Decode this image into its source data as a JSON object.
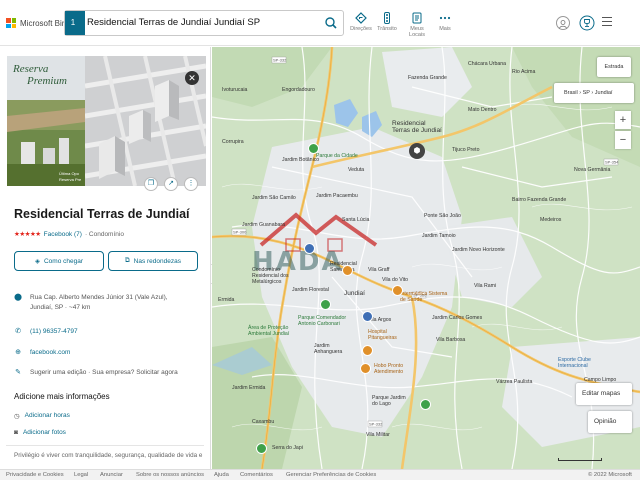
{
  "header": {
    "brand": "Microsoft Bing",
    "route_number": "1",
    "search_query": "Residencial Terras de Jundiaí Jundiaí SP",
    "nav": [
      {
        "label": "Direções",
        "icon": "directions-icon"
      },
      {
        "label": "Trânsito",
        "icon": "traffic-icon"
      },
      {
        "label": "Meus Locais",
        "icon": "my-places-icon"
      },
      {
        "label": "Mais",
        "icon": "more-icon"
      }
    ]
  },
  "panel": {
    "photo_caption_line1": "Reserva",
    "photo_caption_line2": "Premium",
    "photo_small_line1": "Última Opo",
    "photo_small_line2": "Reserva Pre",
    "name": "Residencial Terras de Jundiaí",
    "stars": "★★★★★",
    "reviews": "Facebook (7)",
    "category": "· Condomínio",
    "directions_label": "Como chegar",
    "nearby_label": "Nas redondezas",
    "address": "Rua Cap. Alberto Mendes Júnior 31 (Vale Azul), Jundiaí, SP · ~47 km",
    "phone": "(11) 96357-4797",
    "website": "facebook.com",
    "suggest": "Sugerir uma edição · Sua empresa? Solicitar agora",
    "more_info_title": "Adicione mais informações",
    "add_hours": "Adicionar horas",
    "add_photos": "Adicionar fotos",
    "description": "Privilégio é viver com tranquilidade, segurança, qualidade de vida e a"
  },
  "map": {
    "style_button": "Estrada",
    "location": "Brasil › SP › Jundiaí",
    "zoom_in": "+",
    "zoom_out": "−",
    "edit_maps": "Editar mapas",
    "feedback": "Opinião",
    "watermark": "HADA",
    "labels": [
      {
        "t": "Residencial",
        "c": "big"
      },
      {
        "t": "Terras de Jundiaí",
        "c": "big"
      },
      {
        "t": "Parque da Cidade",
        "c": "green"
      },
      {
        "t": "Veduta",
        "c": "dark"
      },
      {
        "t": "Nova Germânia",
        "c": "dark"
      },
      {
        "t": "Jundiaí",
        "c": "big"
      },
      {
        "t": "Vila Graff",
        "c": "dark"
      },
      {
        "t": "Vila do Vito",
        "c": "dark"
      },
      {
        "t": "Vila Argos",
        "c": "dark"
      },
      {
        "t": "Hospital Pitangueiras",
        "c": "orange"
      },
      {
        "t": "Intermédica Sistema de Saúde",
        "c": "orange"
      },
      {
        "t": "Hobo Pronto Atendimento",
        "c": "orange"
      },
      {
        "t": "Parque Jardim do Lago",
        "c": "dark"
      },
      {
        "t": "Jardim Anhanguera",
        "c": "dark"
      },
      {
        "t": "Condomínio Residencial dos Metalúrgicos",
        "c": "dark"
      },
      {
        "t": "Parque Comendador Antonio Carbonari",
        "c": "green"
      },
      {
        "t": "Área de Proteção Ambiental Jundiaí",
        "c": "green"
      },
      {
        "t": "Vila Militar",
        "c": "dark"
      },
      {
        "t": "Várzea Paulista",
        "c": "dark"
      },
      {
        "t": "Esporte Clube Internacional",
        "c": "blue"
      },
      {
        "t": "Campo Limpo Paulista",
        "c": "dark"
      },
      {
        "t": "Engordadouro",
        "c": "dark"
      },
      {
        "t": "Jardim Botânico",
        "c": "dark"
      },
      {
        "t": "Santa Lúcia",
        "c": "dark"
      },
      {
        "t": "Residencial Santa Lisa",
        "c": "dark"
      },
      {
        "t": "Jardim São Camilo",
        "c": "dark"
      },
      {
        "t": "Jardim Guanabara",
        "c": "dark"
      },
      {
        "t": "Corrupira",
        "c": "dark"
      },
      {
        "t": "Ivoturucaia",
        "c": "dark"
      },
      {
        "t": "Caxambu",
        "c": "dark"
      },
      {
        "t": "Tijuco Preto",
        "c": "dark"
      },
      {
        "t": "Rio Acima",
        "c": "dark"
      },
      {
        "t": "Mato Dentro",
        "c": "dark"
      },
      {
        "t": "Fazenda Grande",
        "c": "dark"
      },
      {
        "t": "Chácara Urbana",
        "c": "dark"
      },
      {
        "t": "Jardim Novo Horizonte",
        "c": "dark"
      },
      {
        "t": "Bairro Fazenda Grande",
        "c": "dark"
      },
      {
        "t": "Jardim Tamoio",
        "c": "dark"
      },
      {
        "t": "Jardim Carlos Gomes",
        "c": "dark"
      },
      {
        "t": "Vila Rami",
        "c": "dark"
      },
      {
        "t": "Medeiros",
        "c": "dark"
      },
      {
        "t": "Ponte São João",
        "c": "dark"
      },
      {
        "t": "Jardim Pacaembu",
        "c": "dark"
      },
      {
        "t": "Vila Barbosa",
        "c": "dark"
      },
      {
        "t": "Jardim Ermida",
        "c": "dark"
      },
      {
        "t": "Serra do Japi",
        "c": "dark"
      },
      {
        "t": "Jardim Florestal",
        "c": "dark"
      },
      {
        "t": "Ermida",
        "c": "dark"
      }
    ]
  },
  "footer": {
    "links": [
      "Privacidade e Cookies",
      "Legal",
      "Anunciar",
      "Sobre os nossos anúncios",
      "Ajuda",
      "Comentários",
      "Gerenciar Preferências de Cookies"
    ],
    "copyright": "© 2022 Microsoft"
  },
  "colors": {
    "accent": "#0a6b8a",
    "map_green": "#cfe2c4",
    "map_urban": "#e9ecee",
    "road": "#ffffff",
    "highway": "#f6d27d",
    "water": "#9cc4ea",
    "star": "#e2231a"
  }
}
